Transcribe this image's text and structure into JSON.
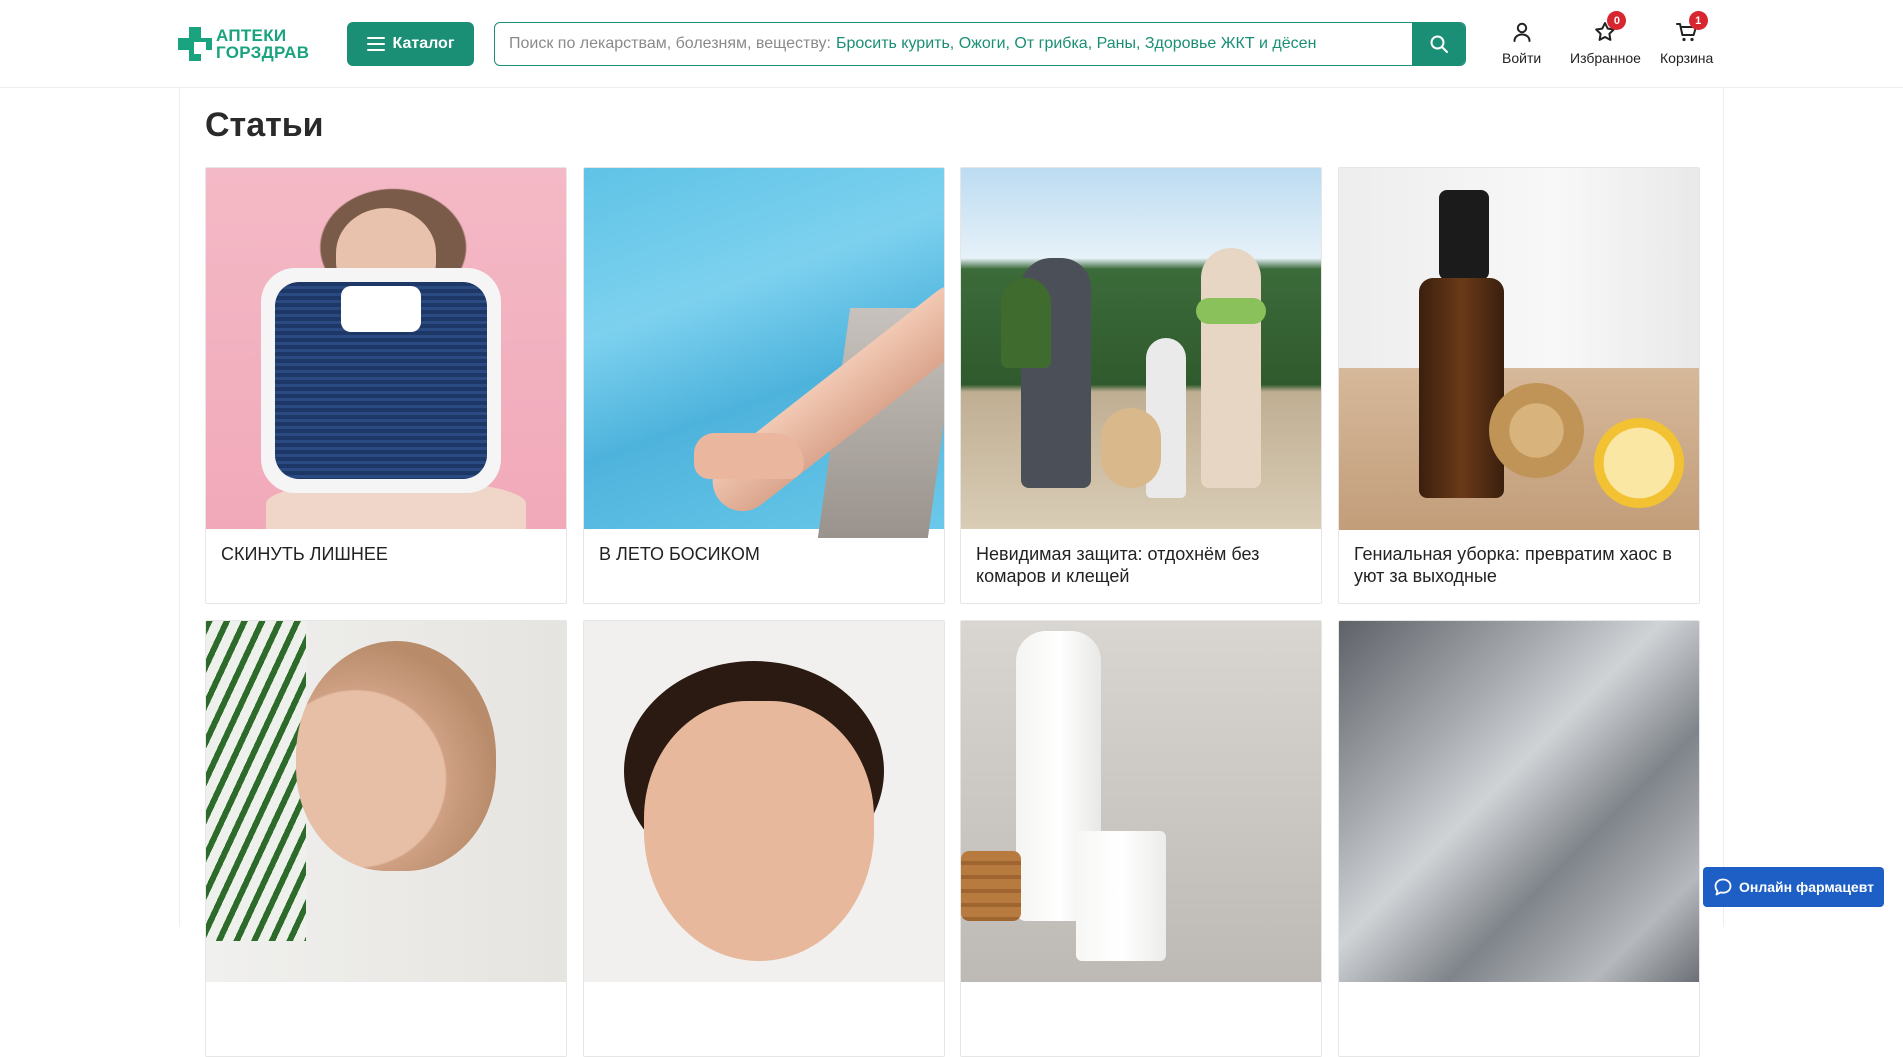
{
  "header": {
    "logo": {
      "line1": "АПТЕКИ",
      "line2": "ГОРЗДРАВ",
      "color": "#1aa37f"
    },
    "catalog_label": "Каталог",
    "search": {
      "placeholder": "Поиск по лекарствам, болезням, веществу:",
      "hints": "Бросить курить, Ожоги, От грибка, Раны, Здоровье ЖКТ и дёсен"
    },
    "actions": {
      "login": {
        "label": "Войти",
        "icon": "user-icon"
      },
      "favorites": {
        "label": "Избранное",
        "icon": "star-icon",
        "count": "0"
      },
      "cart": {
        "label": "Корзина",
        "icon": "cart-icon",
        "count": "1"
      }
    }
  },
  "page": {
    "title": "Статьи"
  },
  "articles": [
    {
      "caption": "СКИНУТЬ ЛИШНЕЕ"
    },
    {
      "caption": "В ЛЕТО БОСИКОМ"
    },
    {
      "caption": "Невидимая защита: отдохнём без комаров и клещей"
    },
    {
      "caption": "Гениальная уборка: превратим хаос в уют за выходные"
    },
    {
      "caption": ""
    },
    {
      "caption": ""
    },
    {
      "caption": ""
    },
    {
      "caption": ""
    }
  ],
  "chat": {
    "label": "Онлайн фармацевт",
    "icon": "chat-bubble-icon"
  },
  "colors": {
    "brand_green": "#1a8f75",
    "badge_red": "#d7262f",
    "chat_blue": "#1d5fc4"
  }
}
